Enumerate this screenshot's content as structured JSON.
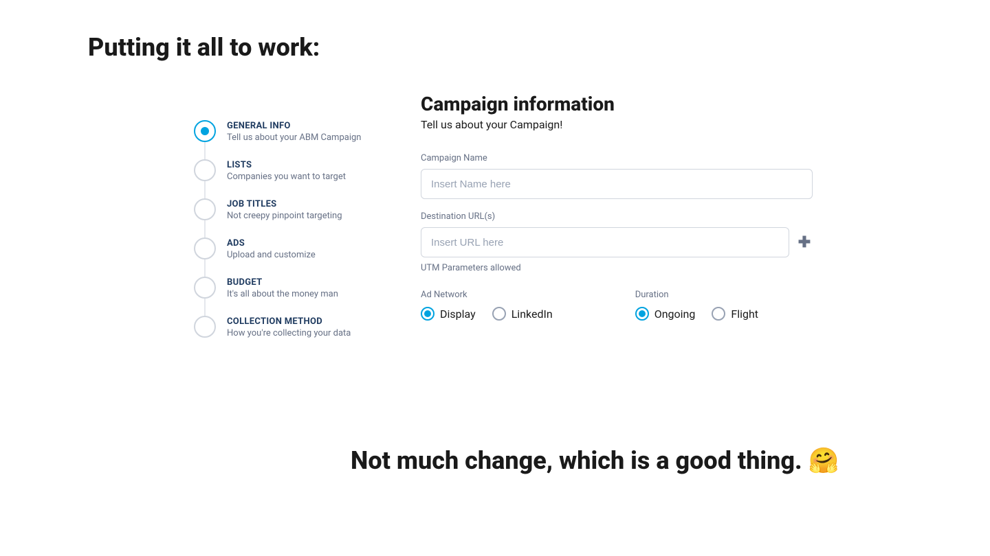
{
  "page_title": "Putting it all to work:",
  "stepper": {
    "steps": [
      {
        "title": "GENERAL INFO",
        "desc": "Tell us about your ABM Campaign",
        "active": true
      },
      {
        "title": "LISTS",
        "desc": "Companies you want to target",
        "active": false
      },
      {
        "title": "JOB TITLES",
        "desc": "Not creepy pinpoint targeting",
        "active": false
      },
      {
        "title": "ADS",
        "desc": "Upload and customize",
        "active": false
      },
      {
        "title": "BUDGET",
        "desc": "It's all about the money man",
        "active": false
      },
      {
        "title": "COLLECTION METHOD",
        "desc": "How you're collecting your data",
        "active": false
      }
    ]
  },
  "form": {
    "heading": "Campaign information",
    "subheading": "Tell us about your Campaign!",
    "campaign_name": {
      "label": "Campaign Name",
      "placeholder": "Insert Name here",
      "value": ""
    },
    "destination_url": {
      "label": "Destination URL(s)",
      "placeholder": "Insert URL here",
      "value": "",
      "helper": "UTM Parameters allowed"
    },
    "ad_network": {
      "label": "Ad Network",
      "options": [
        {
          "label": "Display",
          "selected": true
        },
        {
          "label": "LinkedIn",
          "selected": false
        }
      ]
    },
    "duration": {
      "label": "Duration",
      "options": [
        {
          "label": "Ongoing",
          "selected": true
        },
        {
          "label": "Flight",
          "selected": false
        }
      ]
    }
  },
  "footer_text": "Not much change, which is a good thing. 🤗"
}
